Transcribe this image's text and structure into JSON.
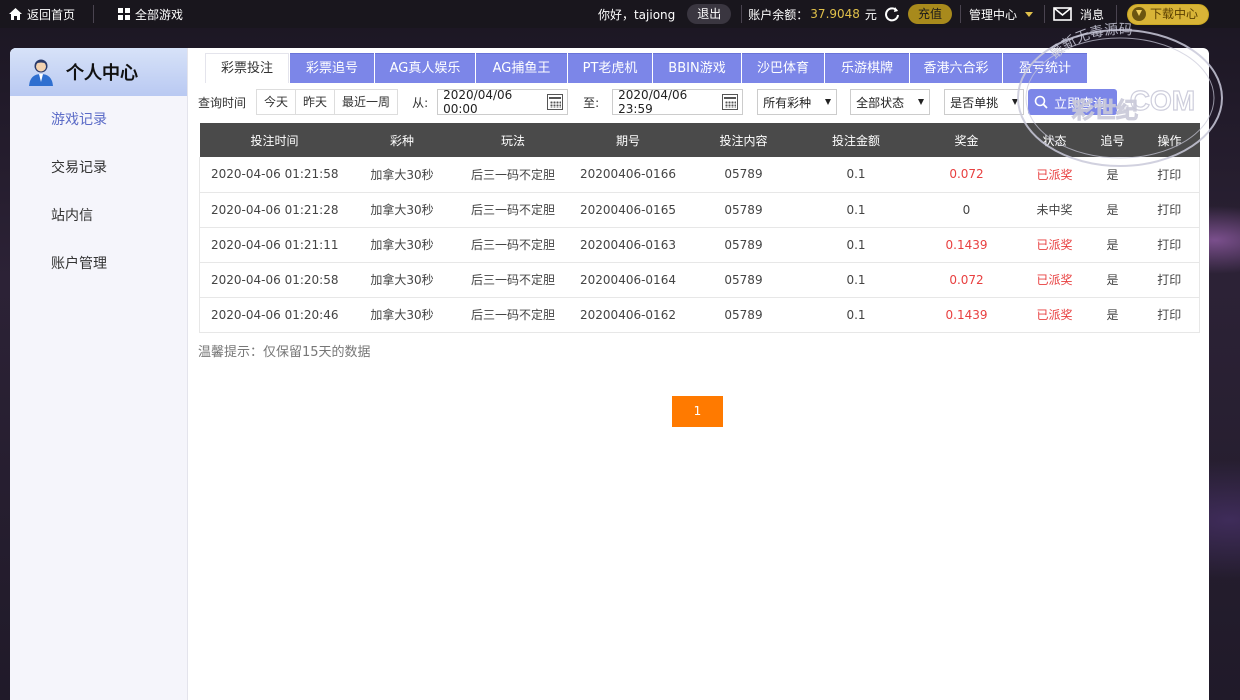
{
  "topbar": {
    "home_label": "返回首页",
    "all_games_label": "全部游戏",
    "greeting": "你好，tajiong",
    "logout_label": "退出",
    "balance_label": "账户余额：",
    "balance_value": "37.9048",
    "balance_unit": "元",
    "recharge_label": "充值",
    "admin_label": "管理中心",
    "messages_label": "消息",
    "download_label": "下载中心"
  },
  "sidebar": {
    "title": "个人中心",
    "items": [
      {
        "label": "游戏记录",
        "active": true
      },
      {
        "label": "交易记录",
        "active": false
      },
      {
        "label": "站内信",
        "active": false
      },
      {
        "label": "账户管理",
        "active": false
      }
    ]
  },
  "tabs": [
    {
      "label": "彩票投注",
      "active": true
    },
    {
      "label": "彩票追号",
      "active": false
    },
    {
      "label": "AG真人娱乐",
      "active": false
    },
    {
      "label": "AG捕鱼王",
      "active": false
    },
    {
      "label": "PT老虎机",
      "active": false
    },
    {
      "label": "BBIN游戏",
      "active": false
    },
    {
      "label": "沙巴体育",
      "active": false
    },
    {
      "label": "乐游棋牌",
      "active": false
    },
    {
      "label": "香港六合彩",
      "active": false
    },
    {
      "label": "盈亏统计",
      "active": false
    }
  ],
  "filter": {
    "query_time_label": "查询时间",
    "quick_ranges": [
      "今天",
      "昨天",
      "最近一周"
    ],
    "from_label": "从:",
    "from_value": "2020/04/06 00:00",
    "to_label": "至:",
    "to_value": "2020/04/06 23:59",
    "lottery_select": "所有彩种",
    "status_select": "全部状态",
    "single_select": "是否单挑",
    "query_button": "立即查询"
  },
  "table": {
    "headers": [
      "投注时间",
      "彩种",
      "玩法",
      "期号",
      "投注内容",
      "投注金额",
      "奖金",
      "状态",
      "追号",
      "操作"
    ],
    "rows": [
      [
        "2020-04-06 01:21:58",
        "加拿大30秒",
        "后三一码不定胆",
        "20200406-0166",
        "05789",
        "0.1",
        "0.072",
        "已派奖",
        "是",
        "打印"
      ],
      [
        "2020-04-06 01:21:28",
        "加拿大30秒",
        "后三一码不定胆",
        "20200406-0165",
        "05789",
        "0.1",
        "0",
        "未中奖",
        "是",
        "打印"
      ],
      [
        "2020-04-06 01:21:11",
        "加拿大30秒",
        "后三一码不定胆",
        "20200406-0163",
        "05789",
        "0.1",
        "0.1439",
        "已派奖",
        "是",
        "打印"
      ],
      [
        "2020-04-06 01:20:58",
        "加拿大30秒",
        "后三一码不定胆",
        "20200406-0164",
        "05789",
        "0.1",
        "0.072",
        "已派奖",
        "是",
        "打印"
      ],
      [
        "2020-04-06 01:20:46",
        "加拿大30秒",
        "后三一码不定胆",
        "20200406-0162",
        "05789",
        "0.1",
        "0.1439",
        "已派奖",
        "是",
        "打印"
      ]
    ],
    "highlight_color": "#e84040"
  },
  "tip": "温馨提示：仅保留15天的数据",
  "pagination": {
    "current": "1"
  },
  "watermark": {
    "line1": "彩世纪",
    "line2": ".COM",
    "arc_text": "最新无毒源码",
    "color": "#c9c9d9"
  }
}
